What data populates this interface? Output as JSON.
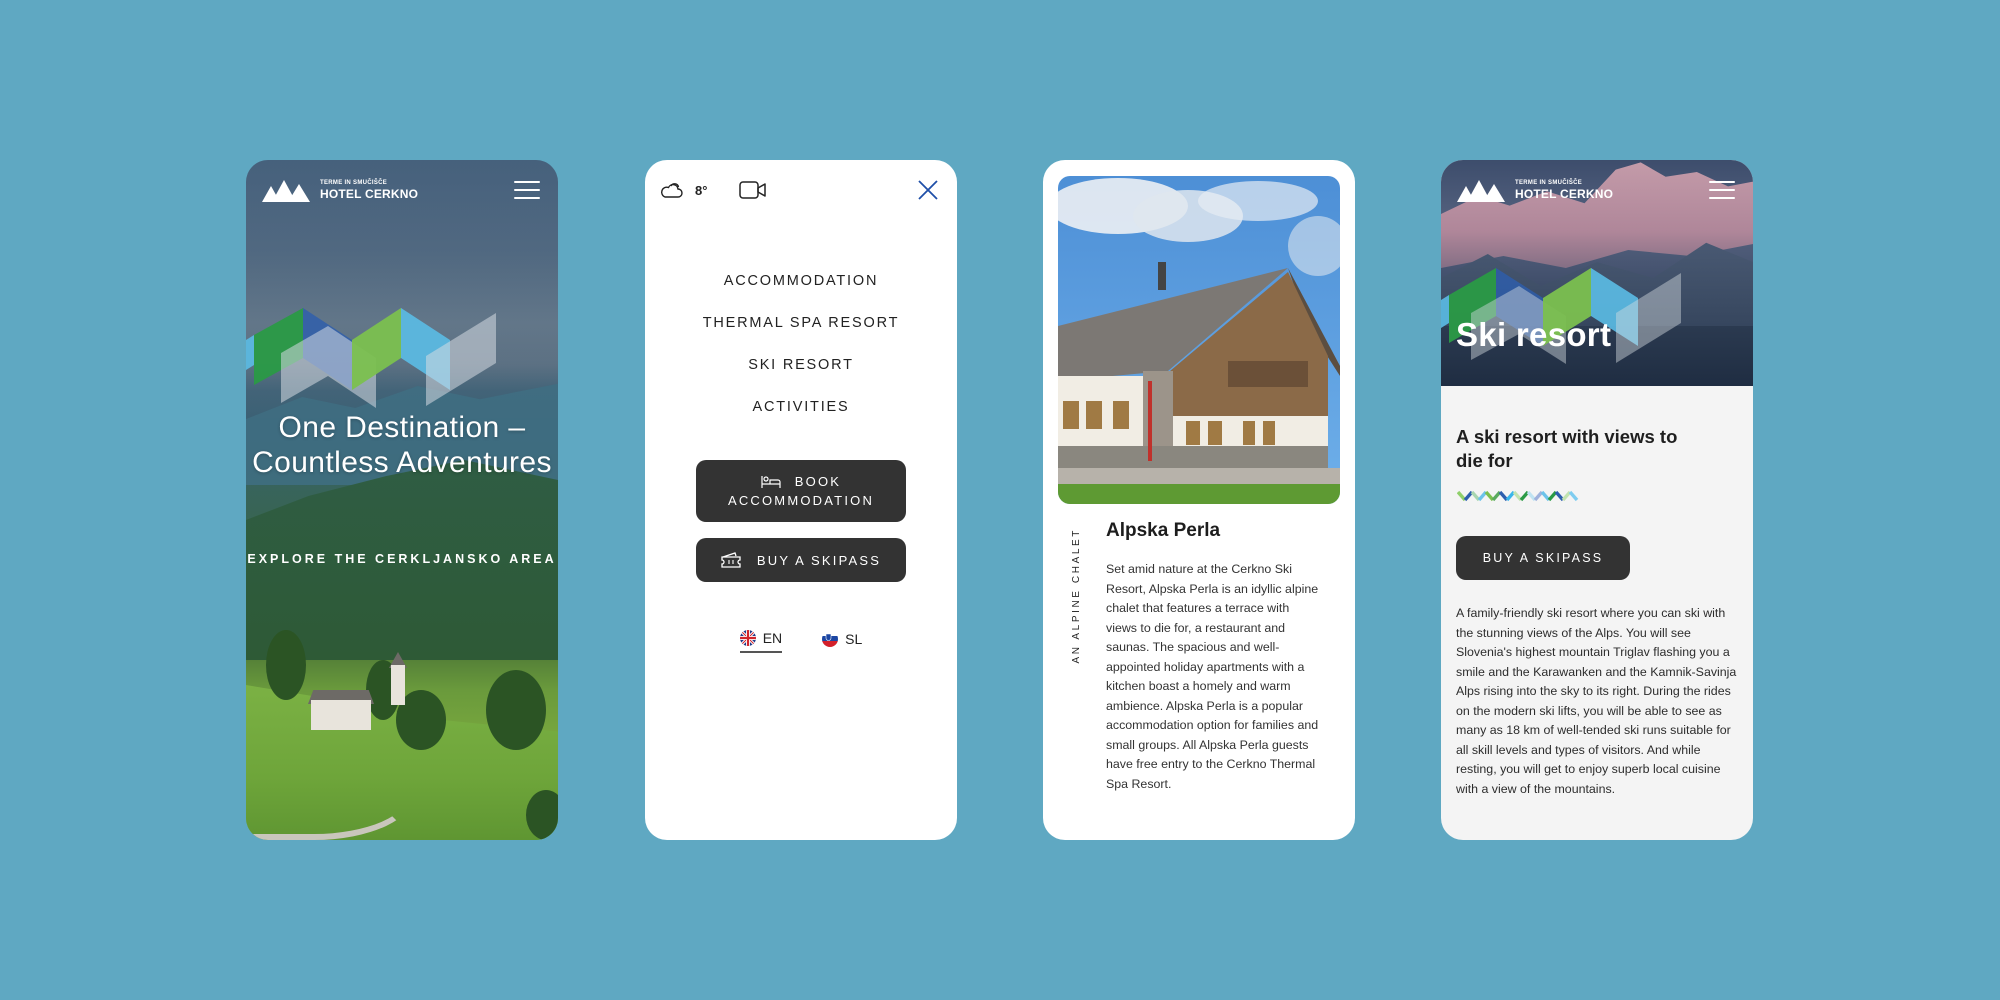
{
  "colors": {
    "background": "#5fa8c2",
    "button_dark": "#333333",
    "close_icon": "#1f4fa8",
    "zig_green": "#2a9a46",
    "zig_lightgreen": "#7bc04f",
    "zig_blue": "#2d5eae",
    "zig_skyblue": "#5bbde6",
    "zig_grey": "#d5dbe1"
  },
  "brand": {
    "small": "TERME IN SMUČIŠČE",
    "big": "HOTEL CERKNO"
  },
  "screen1": {
    "title": "One Destination – Countless Adventures",
    "subtitle": "EXPLORE THE CERKLJANSKO AREA"
  },
  "screen2": {
    "weather_icon": "cloud-icon",
    "temperature": "8°",
    "camera_icon": "video-camera-icon",
    "close_icon": "close-icon",
    "nav": [
      {
        "label": "ACCOMMODATION"
      },
      {
        "label": "THERMAL SPA RESORT"
      },
      {
        "label": "SKI RESORT"
      },
      {
        "label": "ACTIVITIES"
      }
    ],
    "book_button": {
      "line1": "BOOK",
      "line2": "ACCOMMODATION",
      "icon": "bed-icon"
    },
    "skipass_button": {
      "label": "BUY A SKIPASS",
      "icon": "ticket-icon"
    },
    "languages": [
      {
        "code": "EN",
        "active": true,
        "flag": "uk-flag-icon"
      },
      {
        "code": "SL",
        "active": false,
        "flag": "slovenia-flag-icon"
      }
    ]
  },
  "screen3": {
    "vertical_label": "AN ALPINE CHALET",
    "title": "Alpska Perla",
    "body": "Set amid nature at the Cerkno Ski Resort, Alpska Perla is an idyllic alpine chalet that features a terrace with views to die for, a restaurant and saunas. The spacious and well-appointed holiday apartments with a kitchen boast a homely and warm ambience. Alpska Perla is a popular accommodation option for families and small groups. All Alpska Perla guests have free entry to the Cerkno Thermal Spa Resort."
  },
  "screen4": {
    "hero_title": "Ski resort",
    "heading": "A ski resort with views to die for",
    "button": "BUY A SKIPASS",
    "body": "A family-friendly ski resort where you can ski with the stunning views of the Alps. You will see Slovenia's highest mountain Triglav flashing you a smile and the Karawanken and the Kamnik-Savinja Alps rising into the sky to its right. During the rides on the modern ski lifts, you will be able to see as many as 18 km of well-tended ski runs suitable for all skill levels and types of visitors. And while resting, you will get to enjoy superb local cuisine with a view of the mountains."
  }
}
